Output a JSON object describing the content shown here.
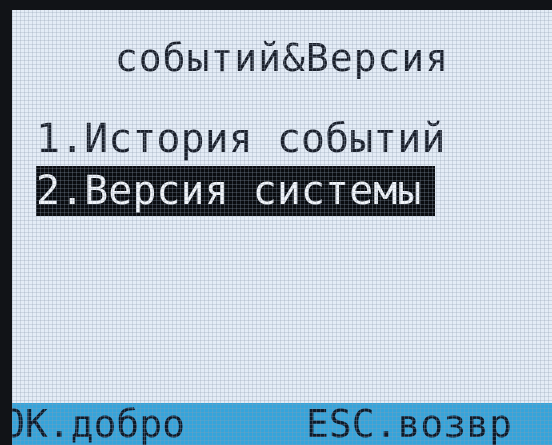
{
  "screen": {
    "title": "событий&Версия"
  },
  "menu": {
    "items": [
      {
        "label": "1.История событий",
        "selected": false
      },
      {
        "label": "2.Версия системы",
        "selected": true
      }
    ]
  },
  "softkeys": {
    "ok_label": "OK.добро",
    "esc_label": "ESC.возвр"
  },
  "colors": {
    "lcd_background": "#e4ecf6",
    "selection_background": "#0a0c10",
    "softkey_bar": "#35a4db",
    "bezel": "#111317"
  }
}
